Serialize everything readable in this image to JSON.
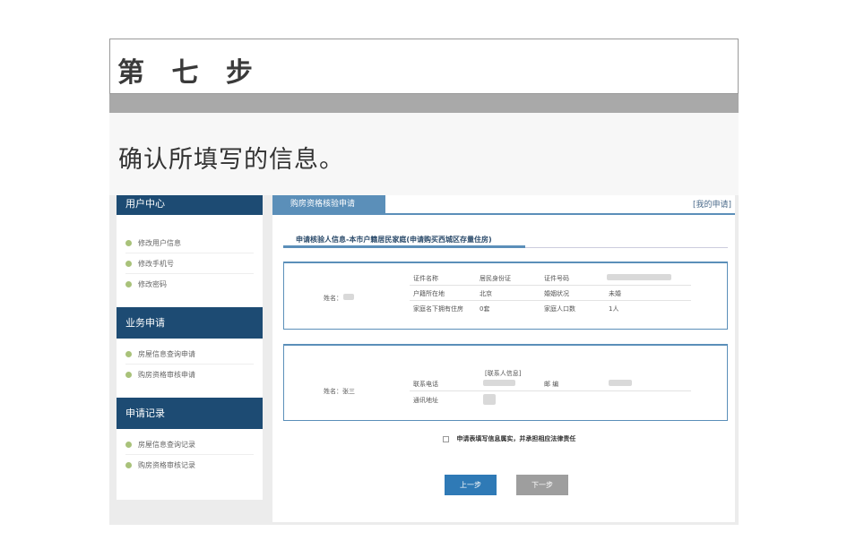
{
  "slide": {
    "step_title": "第 七 步",
    "caption": "确认所填写的信息。"
  },
  "sidebar": {
    "sections": [
      {
        "title": "用户中心",
        "items": [
          "修改用户信息",
          "修改手机号",
          "修改密码"
        ]
      },
      {
        "title": "业务申请",
        "items": [
          "房屋信息查询申请",
          "购房资格审核申请"
        ]
      },
      {
        "title": "申请记录",
        "items": [
          "房屋信息查询记录",
          "购房资格审核记录"
        ]
      }
    ]
  },
  "main": {
    "active_tab": "购房资格核验申请",
    "right_link": "[我的申请]",
    "subtitle": "申请核验人信息-本市户籍居民家庭(申请购买西城区存量住房)",
    "panel1": {
      "name_label": "姓名：",
      "id_type_label": "证件名称",
      "id_type_value": "居民身份证",
      "id_number_label": "证件号码",
      "hukou_label": "户籍所在地",
      "hukou_value": "北京",
      "marital_label": "婚姻状况",
      "marital_value": "未婚",
      "owned_label": "家庭名下拥有住房",
      "owned_value": "0套",
      "members_label": "家庭人口数",
      "members_value": "1人"
    },
    "panel2": {
      "header": "[联系人信息]",
      "name_label": "姓名：张三",
      "phone_label": "联系电话",
      "postcode_label": "邮 编",
      "address_label": "通讯地址"
    },
    "agree_text": "申请表填写信息属实，并承担相应法律责任",
    "buttons": {
      "prev": "上一步",
      "next": "下一步"
    }
  },
  "colors": {
    "nav_dark": "#1d4b73",
    "accent": "#5b8fb9",
    "primary_button": "#2f7ab6",
    "disabled_button": "#9e9e9e",
    "dot": "#a9c27a"
  }
}
